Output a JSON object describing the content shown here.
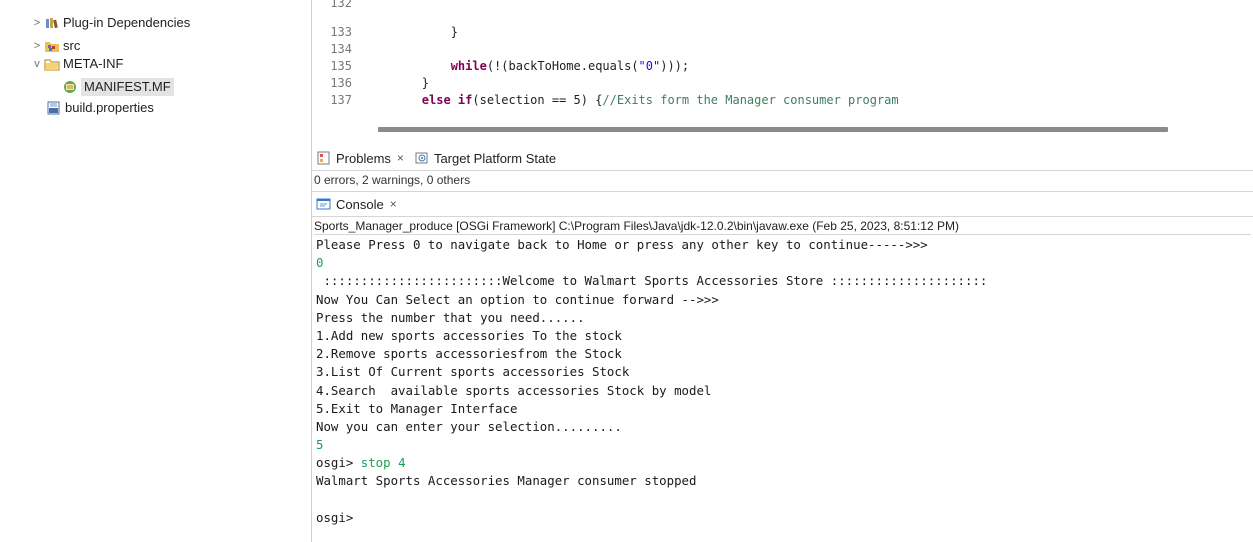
{
  "explorer": {
    "items": [
      {
        "label": "Plug-in Dependencies",
        "chevron": ">",
        "icon": "library-icon"
      },
      {
        "label": "src",
        "chevron": ">",
        "icon": "package-folder-icon"
      },
      {
        "label": "META-INF",
        "chevron": "v",
        "icon": "folder-icon"
      },
      {
        "label": "MANIFEST.MF",
        "chevron": "",
        "icon": "manifest-file-icon"
      },
      {
        "label": "build.properties",
        "chevron": "",
        "icon": "properties-file-icon"
      }
    ]
  },
  "editor": {
    "lines": [
      {
        "num": "132",
        "indent": "",
        "parts": []
      },
      {
        "num": "133",
        "indent": "            ",
        "parts": [
          {
            "t": "}",
            "c": ""
          }
        ]
      },
      {
        "num": "134",
        "indent": "",
        "parts": []
      },
      {
        "num": "135",
        "indent": "            ",
        "parts": [
          {
            "t": "while",
            "c": "kw"
          },
          {
            "t": "(!(backToHome.equals(",
            "c": ""
          },
          {
            "t": "\"0\"",
            "c": "str"
          },
          {
            "t": ")));",
            "c": ""
          }
        ]
      },
      {
        "num": "136",
        "indent": "        ",
        "parts": [
          {
            "t": "}",
            "c": ""
          }
        ]
      },
      {
        "num": "137",
        "indent": "        ",
        "parts": [
          {
            "t": "else if",
            "c": "kw"
          },
          {
            "t": "(selection == 5) {",
            "c": ""
          },
          {
            "t": "//Exits form the Manager consumer program",
            "c": "cmt"
          }
        ]
      }
    ]
  },
  "problems_view": {
    "tabs": [
      {
        "label": "Problems",
        "close": "×"
      },
      {
        "label": "Target Platform State",
        "close": ""
      }
    ],
    "status": "0 errors, 2 warnings, 0 others"
  },
  "console_view": {
    "tab_label": "Console",
    "tab_close": "×",
    "description": "Sports_Manager_produce [OSGi Framework] C:\\Program Files\\Java\\jdk-12.0.2\\bin\\javaw.exe  (Feb 25, 2023, 8:51:12 PM)",
    "lines": [
      {
        "text": "Please Press 0 to navigate back to Home or press any other key to continue----->>>",
        "input": ""
      },
      {
        "text": "",
        "input": "0"
      },
      {
        "text": " ::::::::::::::::::::::::Welcome to Walmart Sports Accessories Store :::::::::::::::::::::",
        "input": ""
      },
      {
        "text": "Now You Can Select an option to continue forward -->>>",
        "input": ""
      },
      {
        "text": "Press the number that you need......",
        "input": ""
      },
      {
        "text": "1.Add new sports accessories To the stock",
        "input": ""
      },
      {
        "text": "2.Remove sports accessoriesfrom the Stock",
        "input": ""
      },
      {
        "text": "3.List Of Current sports accessories Stock",
        "input": ""
      },
      {
        "text": "4.Search  available sports accessories Stock by model",
        "input": ""
      },
      {
        "text": "5.Exit to Manager Interface",
        "input": ""
      },
      {
        "text": "Now you can enter your selection.........",
        "input": ""
      },
      {
        "text": "",
        "input": "5"
      },
      {
        "text": "osgi> ",
        "input": "stop 4"
      },
      {
        "text": "Walmart Sports Accessories Manager consumer stopped",
        "input": ""
      },
      {
        "text": "",
        "input": ""
      },
      {
        "text": "osgi>",
        "input": ""
      }
    ]
  },
  "colors": {
    "keyword": "#7f0055",
    "string": "#2a00ff",
    "comment": "#3f7f5f",
    "console_input": "#1e9e55"
  }
}
